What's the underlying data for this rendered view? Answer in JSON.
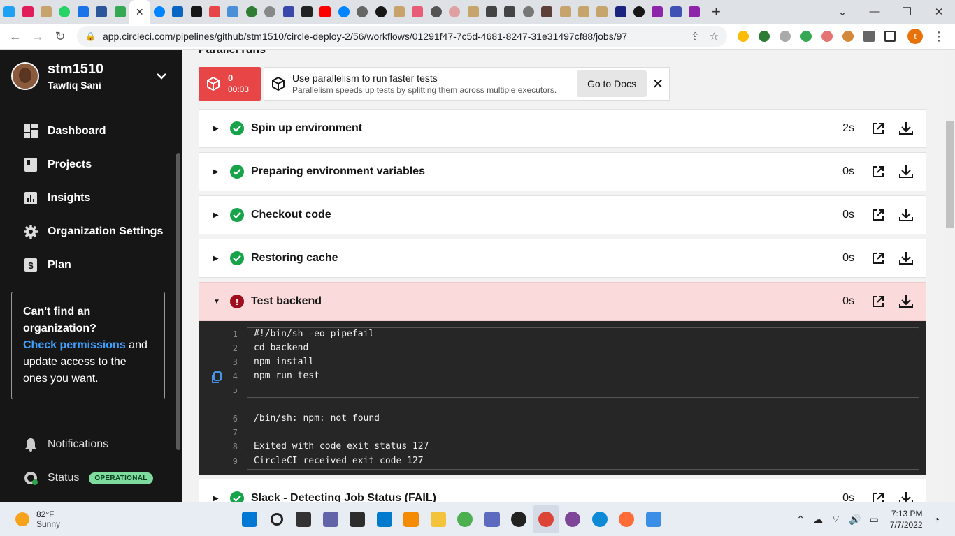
{
  "browser": {
    "url": "app.circleci.com/pipelines/github/stm1510/circle-deploy-2/56/workflows/01291f47-7c5d-4681-8247-31e31497cf88/jobs/97",
    "avatar_letter": "t",
    "new_tab_glyph": "+",
    "close_tab_glyph": "✕"
  },
  "sidebar": {
    "user_name": "stm1510",
    "user_sub": "Tawfiq Sani",
    "nav": [
      {
        "label": "Dashboard",
        "icon": "dashboard-icon"
      },
      {
        "label": "Projects",
        "icon": "projects-icon"
      },
      {
        "label": "Insights",
        "icon": "insights-icon"
      },
      {
        "label": "Organization Settings",
        "icon": "gear-icon"
      },
      {
        "label": "Plan",
        "icon": "dollar-icon"
      }
    ],
    "card": {
      "question": "Can't find an organization?",
      "link": "Check permissions",
      "rest1": " and update access to the ones you want."
    },
    "notifications": "Notifications",
    "status": "Status",
    "status_badge": "OPERATIONAL"
  },
  "main": {
    "section_title": "Parallel runs",
    "run_index": "0",
    "run_time": "00:03",
    "tip_title": "Use parallelism to run faster tests",
    "tip_sub": "Parallelism speeds up tests by splitting them across multiple executors.",
    "docs_button": "Go to Docs",
    "steps": [
      {
        "label": "Spin up environment",
        "duration": "2s",
        "status": "success"
      },
      {
        "label": "Preparing environment variables",
        "duration": "0s",
        "status": "success"
      },
      {
        "label": "Checkout code",
        "duration": "0s",
        "status": "success"
      },
      {
        "label": "Restoring cache",
        "duration": "0s",
        "status": "success"
      },
      {
        "label": "Test backend",
        "duration": "0s",
        "status": "failed"
      },
      {
        "label": "Slack - Detecting Job Status (FAIL)",
        "duration": "0s",
        "status": "success"
      }
    ],
    "console": {
      "lines": [
        {
          "n": "1",
          "text": "#!/bin/sh -eo pipefail"
        },
        {
          "n": "2",
          "text": "cd backend"
        },
        {
          "n": "3",
          "text": "npm install"
        },
        {
          "n": "4",
          "text": "npm run test"
        },
        {
          "n": "5",
          "text": ""
        },
        {
          "n": "6",
          "text": "/bin/sh: npm: not found"
        },
        {
          "n": "7",
          "text": ""
        },
        {
          "n": "8",
          "text": "Exited with code exit status 127"
        },
        {
          "n": "9",
          "text": "CircleCI received exit code 127"
        }
      ]
    }
  },
  "taskbar": {
    "temp": "82°F",
    "weather": "Sunny",
    "time": "7:13 PM",
    "date": "7/7/2022"
  },
  "colors": {
    "success": "#16a34a",
    "failed": "#a00e1d",
    "fail_box": "#e84646",
    "link": "#3fa1ff",
    "badge": "#7ddb9e"
  }
}
